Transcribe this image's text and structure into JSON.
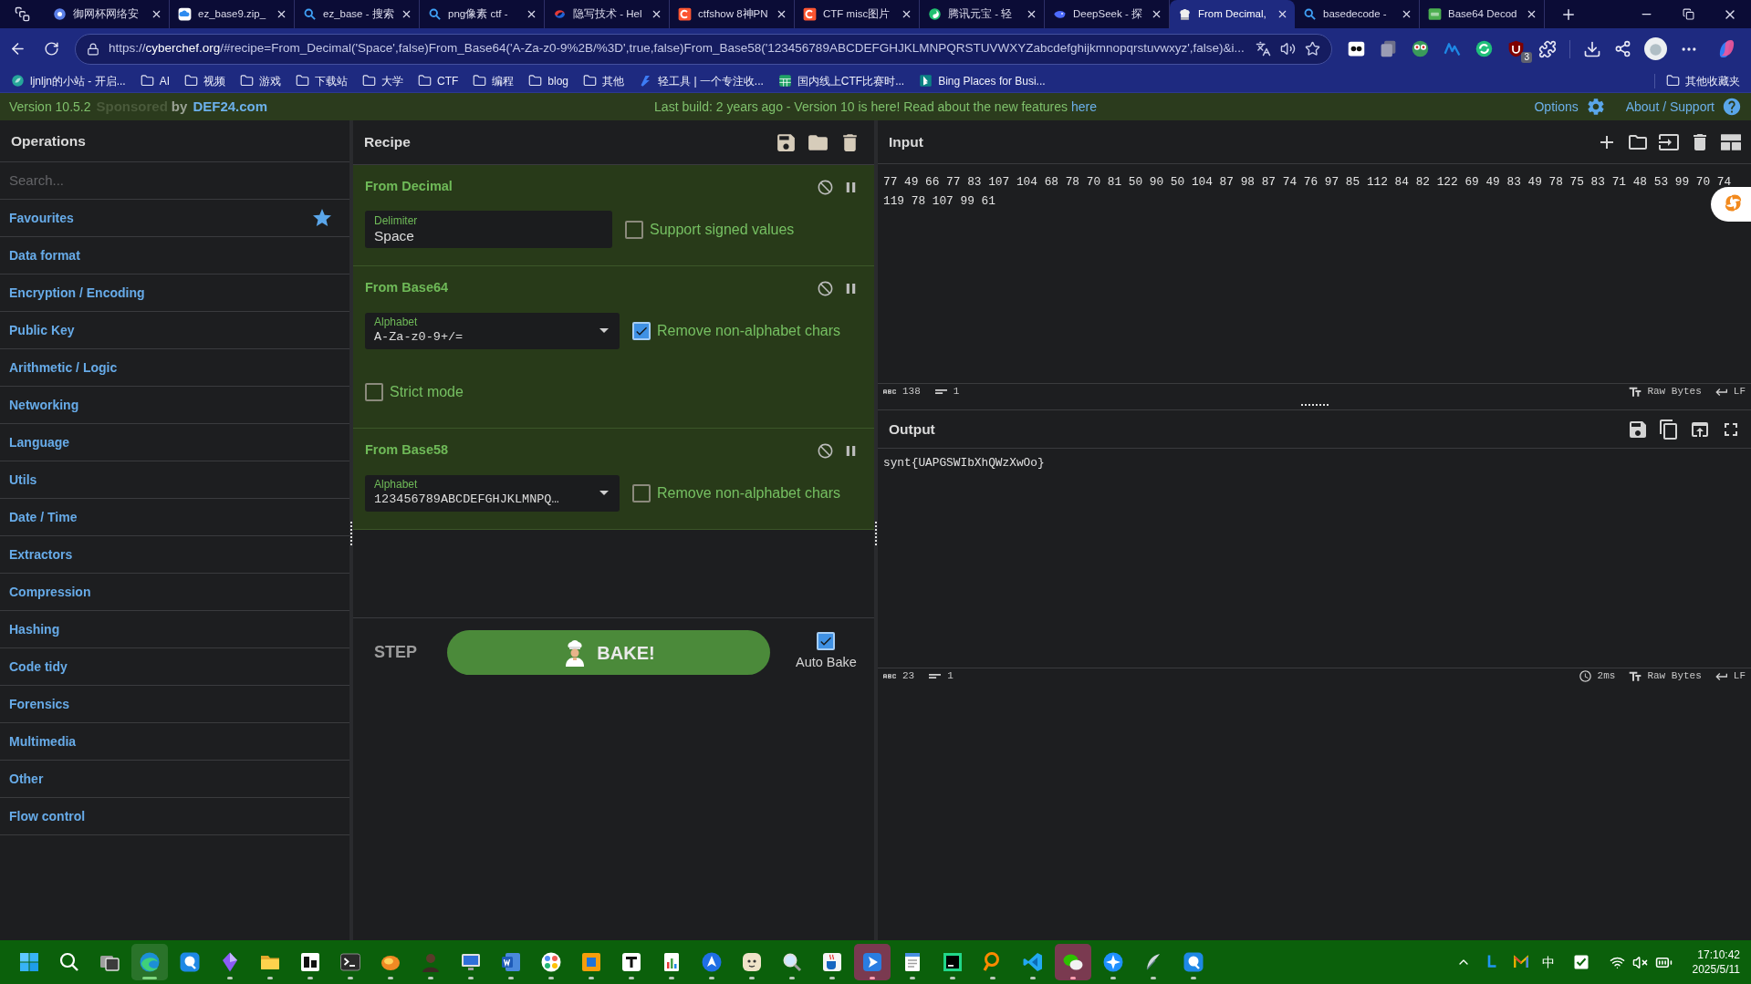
{
  "browser": {
    "tabs": [
      {
        "title": "御网杯网络安",
        "selected": false
      },
      {
        "title": "ez_base9.zip_",
        "selected": false
      },
      {
        "title": "ez_base - 搜索",
        "selected": false
      },
      {
        "title": "png像素 ctf -",
        "selected": false
      },
      {
        "title": "隐写技术 - Hel",
        "selected": false
      },
      {
        "title": "ctfshow 8神PN",
        "selected": false
      },
      {
        "title": "CTF misc图片",
        "selected": false
      },
      {
        "title": "腾讯元宝 - 轻",
        "selected": false
      },
      {
        "title": "DeepSeek - 探",
        "selected": false
      },
      {
        "title": "From Decimal,",
        "selected": true
      },
      {
        "title": "basedecode -",
        "selected": false
      },
      {
        "title": "Base64 Decod",
        "selected": false
      }
    ],
    "address": "https://**cyberchef.org**/#recipe=From_Decimal('Space',false)From_Base64('A-Za-z0-9%2B/%3D',true,false)From_Base58('123456789ABCDEFGHJKLMNPQRSTUVWXYZabcdefghijkmnopqrstuvwxyz',false)&i...",
    "extension_badge": "3",
    "bookmarks": [
      {
        "kind": "site",
        "title": "ljnljn的小站 - 开启..."
      },
      {
        "kind": "folder",
        "title": "AI"
      },
      {
        "kind": "folder",
        "title": "视频"
      },
      {
        "kind": "folder",
        "title": "游戏"
      },
      {
        "kind": "folder",
        "title": "下载站"
      },
      {
        "kind": "folder",
        "title": "大学"
      },
      {
        "kind": "folder",
        "title": "CTF"
      },
      {
        "kind": "folder",
        "title": "编程"
      },
      {
        "kind": "folder",
        "title": "blog"
      },
      {
        "kind": "folder",
        "title": "其他"
      },
      {
        "kind": "site",
        "title": "轻工具 | 一个专注收..."
      },
      {
        "kind": "site",
        "title": "国内线上CTF比赛时..."
      },
      {
        "kind": "site",
        "title": "Bing Places for Busi..."
      }
    ],
    "other_bookmarks": "其他收藏夹"
  },
  "banner": {
    "version": "Version 10.5.2",
    "sponsored": "Sponsored",
    "by": "by",
    "sponsor": "DEF24.com",
    "notice": "Last build: 2 years ago - Version 10 is here! Read about the new features",
    "notice_link": "here",
    "options": "Options",
    "about": "About / Support"
  },
  "operations": {
    "title": "Operations",
    "search_placeholder": "Search...",
    "categories": [
      {
        "kind": "favourites",
        "label": "Favourites"
      },
      {
        "kind": "category",
        "label": "Data format"
      },
      {
        "kind": "category",
        "label": "Encryption / Encoding"
      },
      {
        "kind": "category",
        "label": "Public Key"
      },
      {
        "kind": "category",
        "label": "Arithmetic / Logic"
      },
      {
        "kind": "category",
        "label": "Networking"
      },
      {
        "kind": "category",
        "label": "Language"
      },
      {
        "kind": "category",
        "label": "Utils"
      },
      {
        "kind": "category",
        "label": "Date / Time"
      },
      {
        "kind": "category",
        "label": "Extractors"
      },
      {
        "kind": "category",
        "label": "Compression"
      },
      {
        "kind": "category",
        "label": "Hashing"
      },
      {
        "kind": "category",
        "label": "Code tidy"
      },
      {
        "kind": "category",
        "label": "Forensics"
      },
      {
        "kind": "category",
        "label": "Multimedia"
      },
      {
        "kind": "category",
        "label": "Other"
      },
      {
        "kind": "category",
        "label": "Flow control"
      }
    ]
  },
  "recipe": {
    "title": "Recipe",
    "operations": [
      {
        "name": "From Decimal",
        "disabled": false,
        "breakpoint": false,
        "args": [
          {
            "kind": "text",
            "label": "Delimiter",
            "value": "Space"
          },
          {
            "kind": "checkbox",
            "label": "Support signed values",
            "checked": false
          }
        ]
      },
      {
        "name": "From Base64",
        "disabled": false,
        "breakpoint": false,
        "args": [
          {
            "kind": "select",
            "label": "Alphabet",
            "value": "A-Za-z0-9+/="
          },
          {
            "kind": "checkbox",
            "label": "Remove non-alphabet chars",
            "checked": true
          },
          {
            "kind": "checkbox",
            "label": "Strict mode",
            "checked": false
          }
        ]
      },
      {
        "name": "From Base58",
        "disabled": false,
        "breakpoint": false,
        "args": [
          {
            "kind": "select",
            "label": "Alphabet",
            "value": "123456789ABCDEFGHJKLMNPQ…"
          },
          {
            "kind": "checkbox",
            "label": "Remove non-alphabet chars",
            "checked": false
          }
        ]
      }
    ],
    "step": "STEP",
    "bake": "BAKE!",
    "auto_bake": {
      "label": "Auto Bake",
      "checked": true
    }
  },
  "input": {
    "title": "Input",
    "text": "77 49 66 77 83 107 104 68 78 70 81 50 90 50 104 87 98 87 74 76 97 85 112 84 82 122 69 49 83 49 78 75 83 71 48 53 99 70 74 119 78 107 99 61",
    "status": {
      "length": "138",
      "lines": "1",
      "encoding": "Raw Bytes",
      "eol": "LF"
    }
  },
  "output": {
    "title": "Output",
    "text": "synt{UAPGSWIbXhQWzXwOo}",
    "status": {
      "length": "23",
      "lines": "1",
      "time": "2ms",
      "encoding": "Raw Bytes",
      "eol": "LF"
    }
  },
  "taskbar": {
    "apps": [
      {
        "running": false,
        "selected": false,
        "attention": false
      },
      {
        "running": false,
        "selected": false,
        "attention": false
      },
      {
        "running": false,
        "selected": false,
        "attention": false
      },
      {
        "running": true,
        "selected": true,
        "attention": false
      },
      {
        "running": false,
        "selected": false,
        "attention": false
      },
      {
        "running": true,
        "selected": false,
        "attention": false
      },
      {
        "running": true,
        "selected": false,
        "attention": false
      },
      {
        "running": true,
        "selected": false,
        "attention": false
      },
      {
        "running": true,
        "selected": false,
        "attention": false
      },
      {
        "running": true,
        "selected": false,
        "attention": false
      },
      {
        "running": true,
        "selected": false,
        "attention": false
      },
      {
        "running": true,
        "selected": false,
        "attention": false
      },
      {
        "running": true,
        "selected": false,
        "attention": false
      },
      {
        "running": true,
        "selected": false,
        "attention": false
      },
      {
        "running": true,
        "selected": false,
        "attention": false
      },
      {
        "running": true,
        "selected": false,
        "attention": false
      },
      {
        "running": true,
        "selected": false,
        "attention": false
      },
      {
        "running": true,
        "selected": false,
        "attention": false
      },
      {
        "running": true,
        "selected": false,
        "attention": false
      },
      {
        "running": true,
        "selected": false,
        "attention": false
      },
      {
        "running": true,
        "selected": false,
        "attention": false
      },
      {
        "running": true,
        "selected": false,
        "attention": true
      },
      {
        "running": true,
        "selected": false,
        "attention": false
      },
      {
        "running": true,
        "selected": false,
        "attention": false
      },
      {
        "running": true,
        "selected": false,
        "attention": false
      },
      {
        "running": true,
        "selected": false,
        "attention": false
      },
      {
        "running": true,
        "selected": false,
        "attention": true
      },
      {
        "running": true,
        "selected": false,
        "attention": false
      },
      {
        "running": true,
        "selected": false,
        "attention": false
      },
      {
        "running": true,
        "selected": false,
        "attention": false
      }
    ],
    "ime": "中",
    "time": "17:10:42",
    "date": "2025/5/11"
  }
}
